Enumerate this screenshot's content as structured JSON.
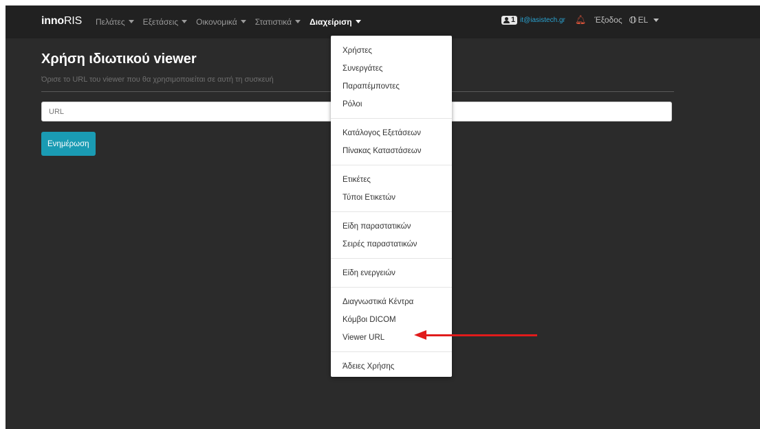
{
  "navbar": {
    "brand_bold": "inno",
    "brand_rest": "RIS",
    "items": [
      {
        "label": "Πελάτες"
      },
      {
        "label": "Εξετάσεις"
      },
      {
        "label": "Οικονομικά"
      },
      {
        "label": "Στατιστικά"
      },
      {
        "label": "Διαχείριση"
      }
    ],
    "active_item": "Διαχείριση",
    "user_badge_count": "1",
    "user_email": "it@iasistech.gr",
    "logout_label": "Έξοδος",
    "language": "EL"
  },
  "page": {
    "title": "Χρήση ιδιωτικού viewer",
    "subtitle": "Όρισε το URL του viewer που θα χρησιμοποιείται σε αυτή τη συσκευή",
    "url_placeholder": "URL",
    "update_button": "Ενημέρωση"
  },
  "dropdown": {
    "groups": [
      [
        "Χρήστες",
        "Συνεργάτες",
        "Παραπέμποντες",
        "Ρόλοι"
      ],
      [
        "Κατάλογος Εξετάσεων",
        "Πίνακας Καταστάσεων"
      ],
      [
        "Ετικέτες",
        "Τύποι Ετικετών"
      ],
      [
        "Είδη παραστατικών",
        "Σειρές παραστατικών"
      ],
      [
        "Είδη ενεργειών"
      ],
      [
        "Διαγνωστικά Κέντρα",
        "Κόμβοι DICOM",
        "Viewer URL"
      ],
      [
        "Άδειες Χρήσης"
      ]
    ],
    "highlighted_item": "Viewer URL"
  },
  "colors": {
    "navbar_bg": "#212121",
    "page_bg": "#2b2b2b",
    "button_bg": "#1a9bb3",
    "email_color": "#2aa3d1",
    "bell_color": "#e0553a",
    "annotation_arrow": "#e11b1b"
  },
  "icons": {
    "user": "user-id-icon",
    "notifications": "bell-icon",
    "language": "globe-icon",
    "dropdown_caret": "caret-down-icon"
  }
}
